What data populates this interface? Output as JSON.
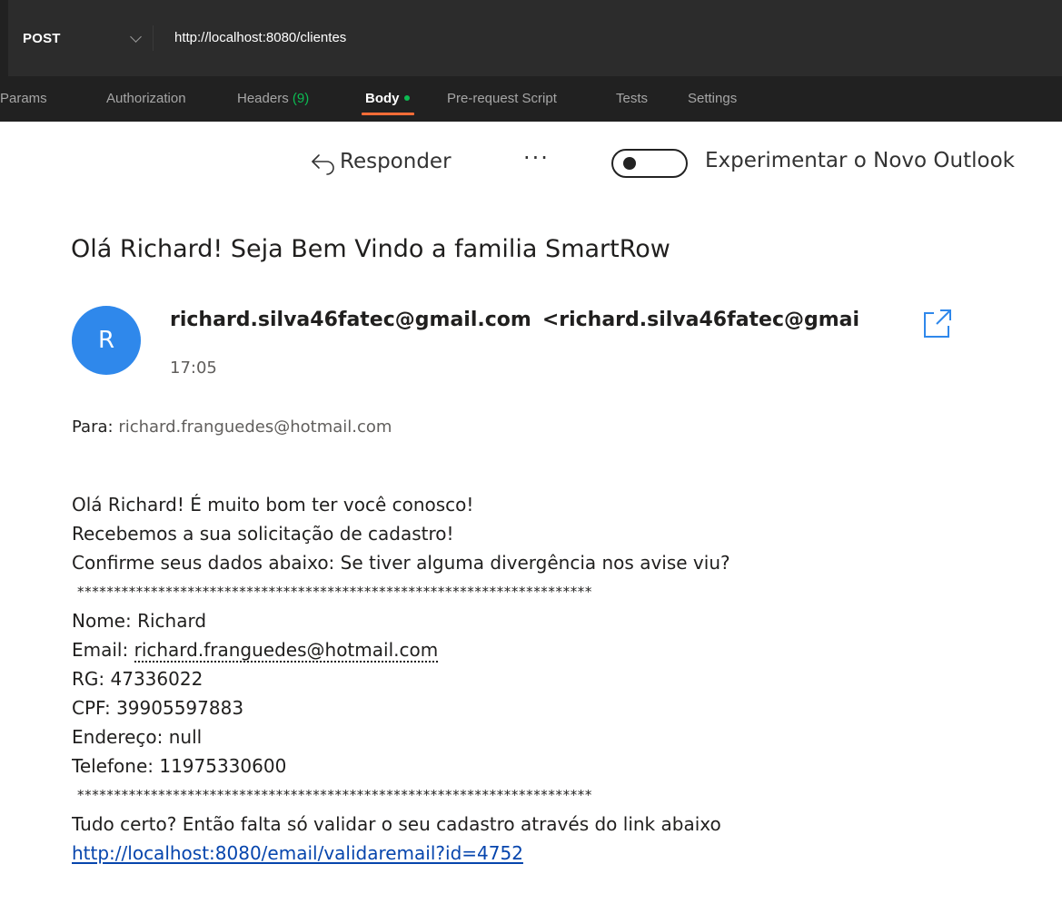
{
  "postman": {
    "method": "POST",
    "url": "http://localhost:8080/clientes",
    "tabs": {
      "params": "Params",
      "authorization": "Authorization",
      "headers": "Headers",
      "headers_count": "(9)",
      "body": "Body",
      "pre_request_script": "Pre-request Script",
      "tests": "Tests",
      "settings": "Settings"
    },
    "active_tab": "Body",
    "accent_color": "#ff6c37",
    "indicator_color": "#0cbb52"
  },
  "outlook": {
    "toolbar": {
      "reply_label": "Responder",
      "more_label": "···",
      "toggle_label": "Experimentar o Novo Outlook",
      "toggle_state": "off"
    },
    "email": {
      "subject": "Olá Richard! Seja Bem Vindo a familia SmartRow",
      "avatar_initial": "R",
      "avatar_color": "#2f88eb",
      "sender_name": "richard.silva46fatec@gmail.com",
      "sender_address": "<richard.silva46fatec@gmai",
      "time": "17:05",
      "to_label": "Para:",
      "to_address": "richard.franguedes@hotmail.com",
      "body": {
        "greeting": "Olá Richard! É muito bom ter você conosco!",
        "received": "Recebemos a sua solicitação de cadastro!",
        "confirm": "Confirme seus dados abaixo: Se tiver alguma divergência nos avise viu?",
        "separator_top": "**********************************************************************",
        "nome": "Nome: Richard",
        "email_label": "Email: ",
        "email_value": "richard.franguedes@hotmail.com",
        "rg": "RG: 47336022",
        "cpf": "CPF: 39905597883",
        "endereco": "Endereço: null",
        "telefone": "Telefone: 11975330600",
        "separator_bottom": "**********************************************************************",
        "closing": "Tudo certo? Então falta só validar o seu cadastro através do link abaixo",
        "validation_link": "http://localhost:8080/email/validaremail?id=4752"
      }
    }
  }
}
